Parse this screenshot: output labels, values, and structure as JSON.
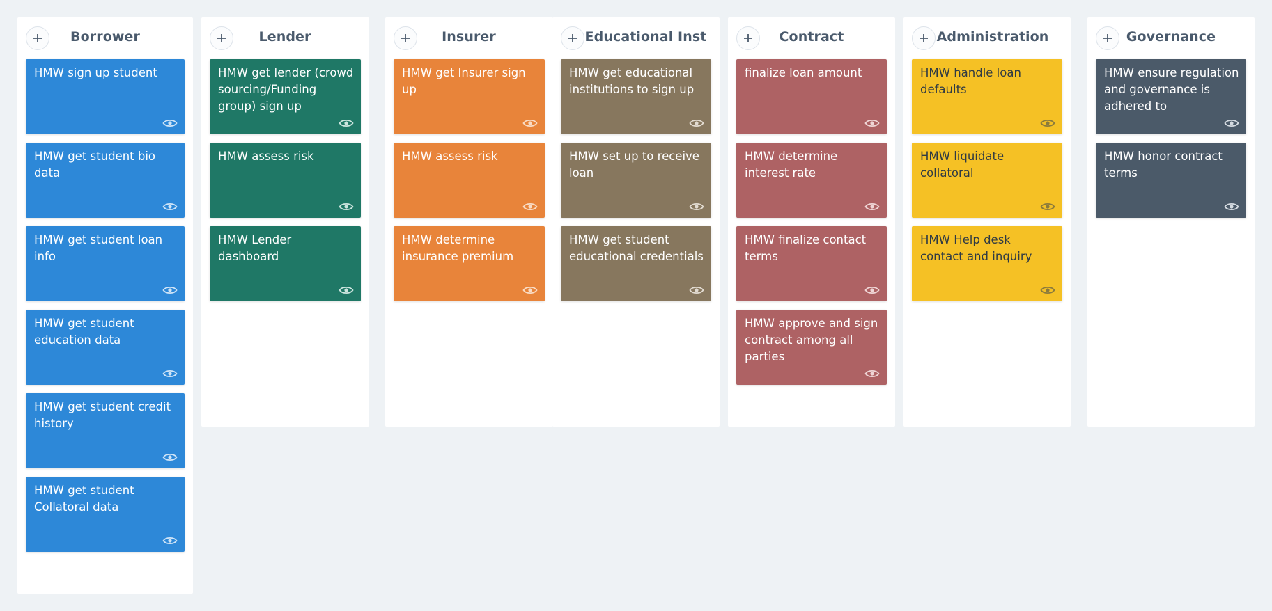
{
  "board": {
    "columns": [
      {
        "id": "borrower",
        "title": "Borrower",
        "color": "#2d88d8",
        "text_color": "#ffffff",
        "icon_color": "#cfe4f7",
        "cards": [
          "HMW sign up student",
          "HMW get student bio data",
          "HMW get student loan info",
          "HMW get student education data",
          "HMW get student credit history",
          "HMW get student Collatoral data"
        ]
      },
      {
        "id": "lender",
        "title": "Lender",
        "color": "#1f7866",
        "text_color": "#ffffff",
        "icon_color": "#cde5df",
        "cards": [
          "HMW get lender (crowd sourcing/Funding group) sign up",
          "HMW assess risk",
          "HMW Lender dashboard"
        ]
      },
      {
        "id": "insurer",
        "title": "Insurer",
        "color": "#e8843a",
        "text_color": "#ffffff",
        "icon_color": "#f9dcc5",
        "cards": [
          "HMW get Insurer sign up",
          "HMW assess risk",
          "HMW determine insurance premium"
        ]
      },
      {
        "id": "educational-inst",
        "title": "Educational Inst",
        "color": "#87775e",
        "text_color": "#ffffff",
        "icon_color": "#e2dbd1",
        "cards": [
          "HMW get educational institutions to  sign up",
          "HMW set up to receive loan",
          "HMW get student educational credentials"
        ]
      },
      {
        "id": "contract",
        "title": "Contract",
        "color": "#ae6264",
        "text_color": "#ffffff",
        "icon_color": "#efd6d6",
        "cards": [
          "finalize loan amount",
          "HMW determine interest rate",
          "HMW finalize contact terms",
          "HMW approve and sign contract among all parties"
        ]
      },
      {
        "id": "administration",
        "title": "Administration",
        "color": "#f5c125",
        "text_color": "#2f3a44",
        "icon_color": "#8a7a3c",
        "cards": [
          "HMW handle loan defaults",
          "HMW liquidate collatoral",
          "HMW Help desk contact and inquiry"
        ]
      },
      {
        "id": "governance",
        "title": "Governance",
        "color": "#4b5a69",
        "text_color": "#ffffff",
        "icon_color": "#d5dbe1",
        "cards": [
          "HMW ensure regulation and governance is adhered to",
          "HMW honor contract terms"
        ]
      }
    ]
  },
  "icons": {
    "add": "plus-icon",
    "view": "eye-icon"
  }
}
